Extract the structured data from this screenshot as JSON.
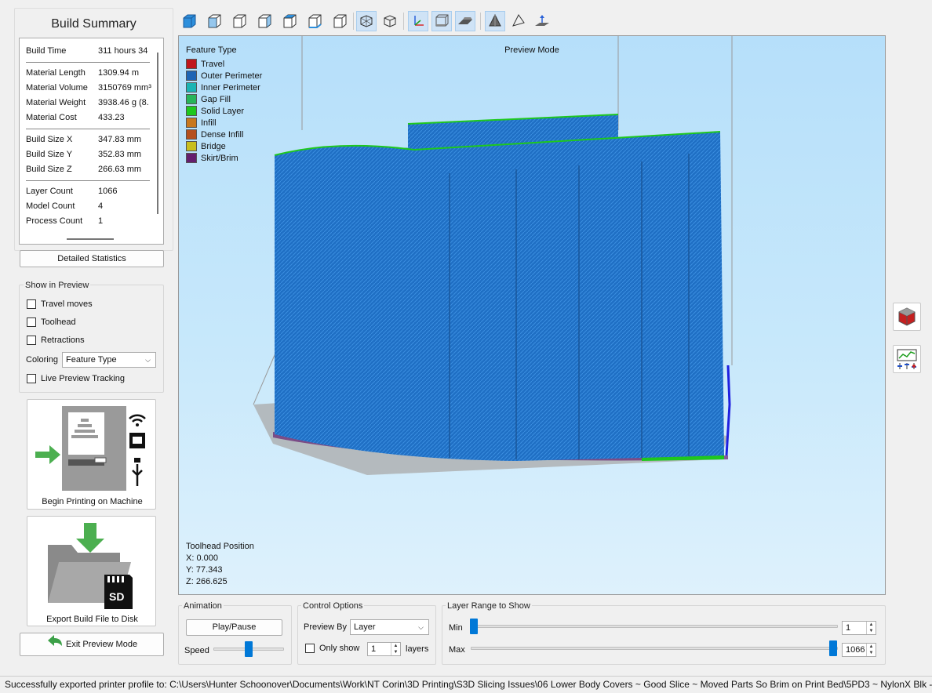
{
  "sidebar": {
    "title": "Build Summary",
    "summary_rows": [
      {
        "key": "Build Time",
        "value": "311 hours 34"
      },
      {
        "key": "Material Length",
        "value": "1309.94 m"
      },
      {
        "key": "Material Volume",
        "value": "3150769 mm³"
      },
      {
        "key": "Material Weight",
        "value": "3938.46 g (8."
      },
      {
        "key": "Material Cost",
        "value": "433.23"
      },
      {
        "key": "Build Size X",
        "value": "347.83 mm"
      },
      {
        "key": "Build Size Y",
        "value": "352.83 mm"
      },
      {
        "key": "Build Size Z",
        "value": "266.63 mm"
      },
      {
        "key": "Layer Count",
        "value": "1066"
      },
      {
        "key": "Model Count",
        "value": "4"
      },
      {
        "key": "Process Count",
        "value": "1"
      }
    ],
    "detailed_stats_label": "Detailed Statistics",
    "show_in_preview": {
      "label": "Show in Preview",
      "travel_moves": "Travel moves",
      "toolhead": "Toolhead",
      "retractions": "Retractions",
      "coloring_label": "Coloring",
      "coloring_value": "Feature Type",
      "live_preview": "Live Preview Tracking"
    },
    "begin_printing_label": "Begin Printing on Machine",
    "export_label": "Export Build File to Disk",
    "sd_label": "SD",
    "exit_preview_label": "Exit Preview Mode"
  },
  "viewport": {
    "mode_label": "Preview Mode",
    "legend_title": "Feature Type",
    "legend": [
      {
        "name": "Travel",
        "color": "#c0161c"
      },
      {
        "name": "Outer Perimeter",
        "color": "#1e64b4"
      },
      {
        "name": "Inner Perimeter",
        "color": "#1ab4b4"
      },
      {
        "name": "Gap Fill",
        "color": "#27b45a"
      },
      {
        "name": "Solid Layer",
        "color": "#1ec81e"
      },
      {
        "name": "Infill",
        "color": "#c8781e"
      },
      {
        "name": "Dense Infill",
        "color": "#b4501e"
      },
      {
        "name": "Bridge",
        "color": "#c8be1e"
      },
      {
        "name": "Skirt/Brim",
        "color": "#641e6e"
      }
    ],
    "toolhead_title": "Toolhead Position",
    "toolhead_x": "X: 0.000",
    "toolhead_y": "Y: 77.343",
    "toolhead_z": "Z: 266.625"
  },
  "animation": {
    "label": "Animation",
    "play_pause": "Play/Pause",
    "speed_label": "Speed",
    "speed_level": 0.5
  },
  "control_options": {
    "label": "Control Options",
    "preview_by_label": "Preview By",
    "preview_by_value": "Layer",
    "only_show_label": "Only show",
    "only_show_value": "1",
    "layers_label": "layers"
  },
  "layer_range": {
    "label": "Layer Range to Show",
    "min_label": "Min",
    "min_value": "1",
    "max_label": "Max",
    "max_value": "1066"
  },
  "status_bar": "Successfully exported printer profile to: C:\\Users\\Hunter Schoonover\\Documents\\Work\\NT Corin\\3D Printing\\S3D Slicing Issues\\06 Lower Body Covers ~ Good Slice ~ Moved Parts So Brim on Print Bed\\5PD3 ~ NylonX Blk -"
}
